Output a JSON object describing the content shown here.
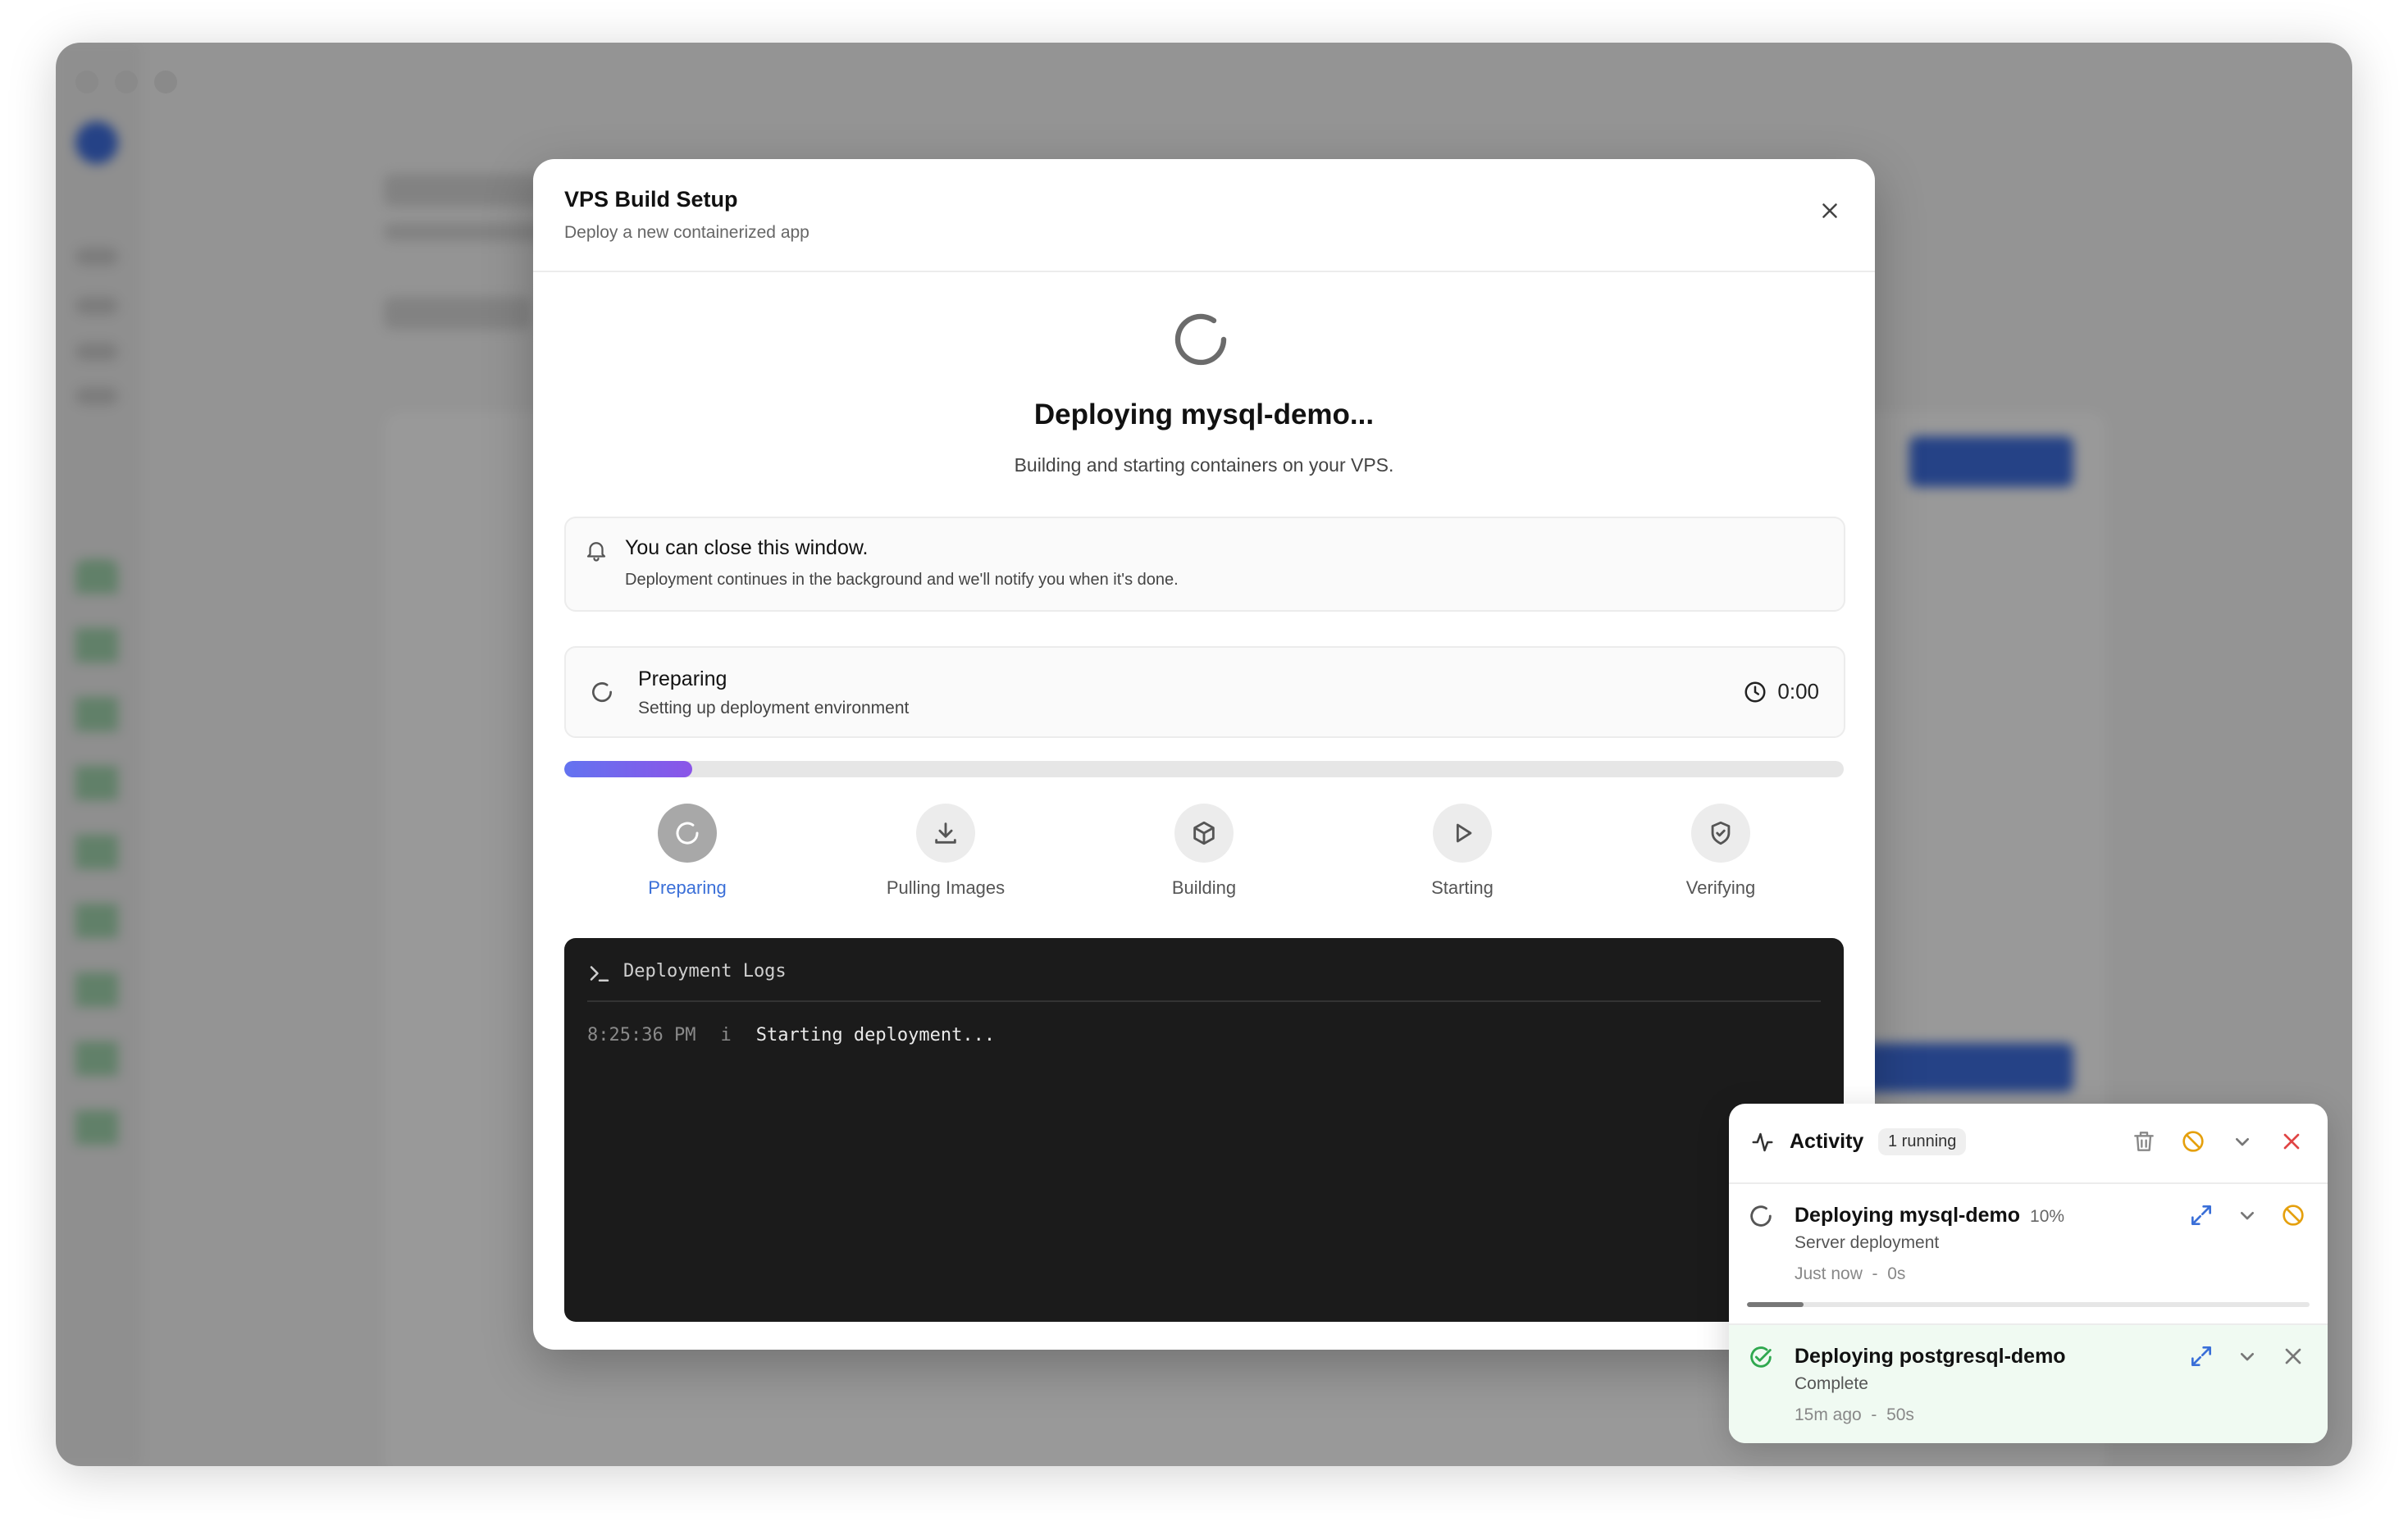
{
  "modal": {
    "title": "VPS Build Setup",
    "subtitle": "Deploy a new containerized app",
    "heading": "Deploying mysql-demo...",
    "description": "Building and starting containers on your VPS.",
    "notice": {
      "title": "You can close this window.",
      "text": "Deployment continues in the background and we'll notify you when it's done."
    },
    "stage": {
      "title": "Preparing",
      "subtitle": "Setting up deployment environment",
      "elapsed": "0:00"
    },
    "progress_fraction": 0.1,
    "steps": [
      {
        "label": "Preparing",
        "icon": "spinner-icon",
        "active": true
      },
      {
        "label": "Pulling Images",
        "icon": "download-icon",
        "active": false
      },
      {
        "label": "Building",
        "icon": "package-icon",
        "active": false
      },
      {
        "label": "Starting",
        "icon": "play-icon",
        "active": false
      },
      {
        "label": "Verifying",
        "icon": "shield-check-icon",
        "active": false
      }
    ],
    "logs": {
      "title": "Deployment Logs",
      "lines": [
        {
          "time": "8:25:36 PM",
          "level": "i",
          "message": "Starting deployment..."
        }
      ]
    }
  },
  "activity": {
    "title": "Activity",
    "badge": "1 running",
    "jobs": [
      {
        "title": "Deploying mysql-demo",
        "percent": "10%",
        "subtitle": "Server deployment",
        "when": "Just now",
        "sep": "-",
        "duration": "0s",
        "progress_fraction": 0.1,
        "status": "running"
      },
      {
        "title": "Deploying postgresql-demo",
        "subtitle": "Complete",
        "when": "15m ago",
        "sep": "-",
        "duration": "50s",
        "status": "complete"
      }
    ]
  },
  "colors": {
    "accent": "#3a6fd8",
    "progress_start": "#6373f0",
    "progress_end": "#8b55e8",
    "success": "#2fa84f",
    "warning": "#e5a00d",
    "danger": "#e04444"
  }
}
